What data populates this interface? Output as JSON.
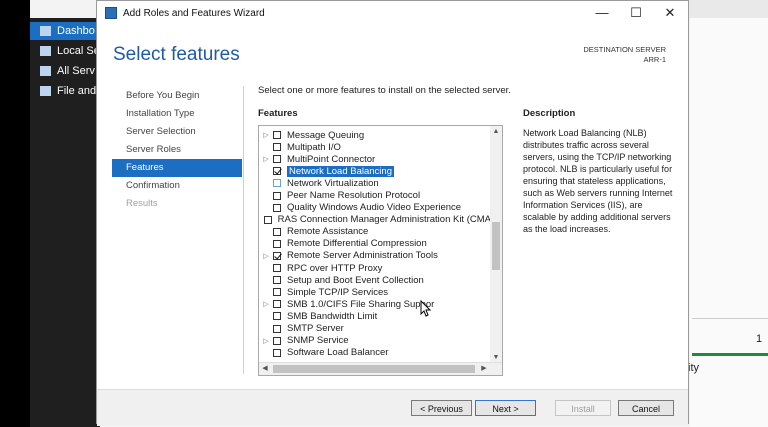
{
  "background": {
    "nav": [
      {
        "label": "Dashbo"
      },
      {
        "label": "Local Se"
      },
      {
        "label": "All Serv"
      },
      {
        "label": "File and"
      }
    ],
    "right_count": "1",
    "right_text": "ity"
  },
  "window": {
    "title": "Add Roles and Features Wizard",
    "minimize": "—",
    "maximize": "☐",
    "close": "✕"
  },
  "header": {
    "title": "Select features",
    "dest_label": "DESTINATION SERVER",
    "dest_server": "ARR-1"
  },
  "steps": [
    {
      "label": "Before You Begin",
      "state": "normal"
    },
    {
      "label": "Installation Type",
      "state": "normal"
    },
    {
      "label": "Server Selection",
      "state": "normal"
    },
    {
      "label": "Server Roles",
      "state": "normal"
    },
    {
      "label": "Features",
      "state": "active"
    },
    {
      "label": "Confirmation",
      "state": "normal"
    },
    {
      "label": "Results",
      "state": "disabled"
    }
  ],
  "instruction": "Select one or more features to install on the selected server.",
  "features_heading": "Features",
  "features": [
    {
      "label": "Message Queuing",
      "expandable": true,
      "checked": false
    },
    {
      "label": "Multipath I/O",
      "expandable": false,
      "checked": false
    },
    {
      "label": "MultiPoint Connector",
      "expandable": true,
      "checked": false
    },
    {
      "label": "Network Load Balancing",
      "expandable": false,
      "checked": true,
      "selected": true
    },
    {
      "label": "Network Virtualization",
      "expandable": false,
      "checked": false,
      "focus": true
    },
    {
      "label": "Peer Name Resolution Protocol",
      "expandable": false,
      "checked": false
    },
    {
      "label": "Quality Windows Audio Video Experience",
      "expandable": false,
      "checked": false
    },
    {
      "label": "RAS Connection Manager Administration Kit (CMA",
      "expandable": false,
      "checked": false
    },
    {
      "label": "Remote Assistance",
      "expandable": false,
      "checked": false
    },
    {
      "label": "Remote Differential Compression",
      "expandable": false,
      "checked": false
    },
    {
      "label": "Remote Server Administration Tools",
      "expandable": true,
      "checked": true
    },
    {
      "label": "RPC over HTTP Proxy",
      "expandable": false,
      "checked": false
    },
    {
      "label": "Setup and Boot Event Collection",
      "expandable": false,
      "checked": false
    },
    {
      "label": "Simple TCP/IP Services",
      "expandable": false,
      "checked": false
    },
    {
      "label": "SMB 1.0/CIFS File Sharing Suppor",
      "expandable": true,
      "checked": false
    },
    {
      "label": "SMB Bandwidth Limit",
      "expandable": false,
      "checked": false
    },
    {
      "label": "SMTP Server",
      "expandable": false,
      "checked": false
    },
    {
      "label": "SNMP Service",
      "expandable": true,
      "checked": false
    },
    {
      "label": "Software Load Balancer",
      "expandable": false,
      "checked": false
    }
  ],
  "description": {
    "heading": "Description",
    "text": "Network Load Balancing (NLB) distributes traffic across several servers, using the TCP/IP networking protocol. NLB is particularly useful for ensuring that stateless applications, such as Web servers running Internet Information Services (IIS), are scalable by adding additional servers as the load increases."
  },
  "buttons": {
    "previous": "< Previous",
    "next": "Next >",
    "install": "Install",
    "cancel": "Cancel"
  },
  "colors": {
    "accent": "#1b6ec2",
    "title_blue": "#1e5aa8"
  }
}
